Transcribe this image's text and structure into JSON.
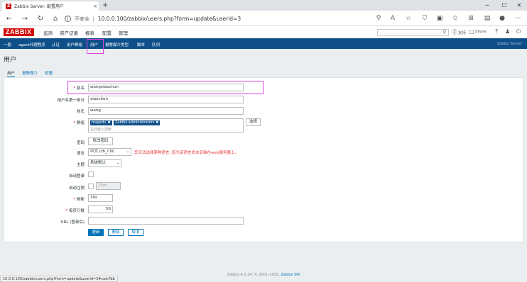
{
  "browser": {
    "tab_title": "Zabbix Server: 配置用户",
    "tab_close": "×",
    "new_tab": "+",
    "insecure_label": "不安全",
    "url": "10.0.0.100/zabbix/users.php?form=update&userid=3",
    "status_url": "10.0.0.100/zabbix/users.php?form=update&userid=3#userTab"
  },
  "zabbix": {
    "logo": "ZABBIX",
    "top_menu": [
      "监测",
      "资产记录",
      "报表",
      "配置",
      "管理"
    ],
    "support_label": "支持",
    "share_label": "Share",
    "help_label": "?",
    "sub_menu": [
      "一般",
      "agent代理程序",
      "认证",
      "用户群组",
      "用户",
      "报警媒介类型",
      "脚本",
      "队列"
    ],
    "server_name": "Zabbix Server"
  },
  "page": {
    "title": "用户",
    "tabs": [
      "用户",
      "报警媒介",
      "权限"
    ]
  },
  "form": {
    "alias_label": "别名",
    "alias_value": "wangxiaochun",
    "name_label": "用户名第一部分",
    "name_value": "xiaochun",
    "surname_label": "姓氏",
    "surname_value": "wang",
    "groups_label": "群组",
    "groups": [
      "magedu",
      "Zabbix administrators"
    ],
    "groups_placeholder": "在此输入搜索",
    "select_button": "选择",
    "password_label": "密码",
    "change_password_button": "修改密码",
    "language_label": "语言",
    "language_value": "中文 (zh_CN)",
    "language_warning": "您无法选择某种语言, 因为该语言尚未安装在web服务器上。",
    "theme_label": "主题",
    "theme_value": "系统默认",
    "autologin_label": "自动登录",
    "autologout_label": "自动注销",
    "autologout_value": "15m",
    "refresh_label": "刷新",
    "refresh_value": "30s",
    "rows_label": "每页行数",
    "rows_value": "50",
    "url_label": "URL (登录后)",
    "url_value": "",
    "update_button": "更新",
    "delete_button": "删除",
    "cancel_button": "取消"
  },
  "footer": {
    "text": "Zabbix 4.0.24. © 2001–2020,",
    "link": "Zabbix SIA"
  },
  "colors": {
    "brand": "#d40000",
    "nav": "#0e4f8a",
    "link": "#0275b8",
    "highlight": "#e040e0",
    "warning": "#e33734"
  }
}
